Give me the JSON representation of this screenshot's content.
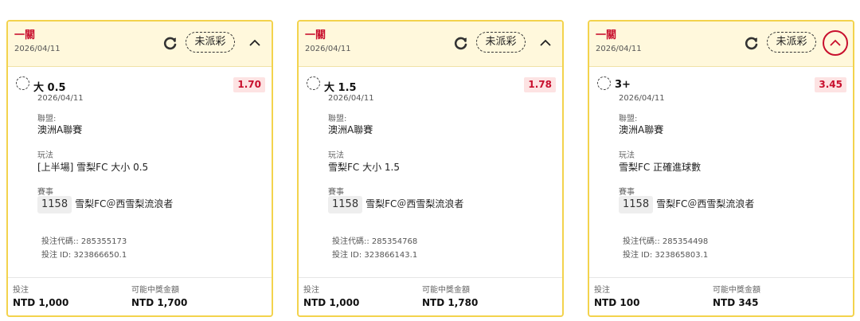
{
  "icons": {
    "refresh": "refresh-icon",
    "collapse": "chevron-up-icon",
    "radio": "radio-circle-icon"
  },
  "colors": {
    "border": "#f3d34d",
    "header_bg": "#fff8dc",
    "accent": "#c8102e",
    "odds_bg": "#fde3e3"
  },
  "cards": [
    {
      "title": "一關",
      "date": "2026/04/11",
      "status": "未派彩",
      "selection": "大 0.5",
      "odds": "1.70",
      "sel_date": "2026/04/11",
      "league_label": "聯盟:",
      "league": "澳洲A聯賽",
      "bet_type_label": "玩法",
      "bet_type": "[上半場] 雪梨FC 大小 0.5",
      "event_label": "賽事",
      "event_id": "1158",
      "event": "雪梨FC＠西雪梨流浪者",
      "bet_code": "投注代碼:: 285355173",
      "bet_id": "投注 ID: 323866650.1",
      "stake_label": "投注",
      "stake": "NTD 1,000",
      "win_label": "可能中獎金額",
      "win": "NTD 1,700"
    },
    {
      "title": "一關",
      "date": "2026/04/11",
      "status": "未派彩",
      "selection": "大 1.5",
      "odds": "1.78",
      "sel_date": "2026/04/11",
      "league_label": "聯盟:",
      "league": "澳洲A聯賽",
      "bet_type_label": "玩法",
      "bet_type": "雪梨FC 大小 1.5",
      "event_label": "賽事",
      "event_id": "1158",
      "event": "雪梨FC＠西雪梨流浪者",
      "bet_code": "投注代碼:: 285354768",
      "bet_id": "投注 ID: 323866143.1",
      "stake_label": "投注",
      "stake": "NTD 1,000",
      "win_label": "可能中獎金額",
      "win": "NTD 1,780"
    },
    {
      "title": "一關",
      "date": "2026/04/11",
      "status": "未派彩",
      "selection": "3+",
      "odds": "3.45",
      "sel_date": "2026/04/11",
      "league_label": "聯盟:",
      "league": "澳洲A聯賽",
      "bet_type_label": "玩法",
      "bet_type": "雪梨FC 正確進球數",
      "event_label": "賽事",
      "event_id": "1158",
      "event": "雪梨FC＠西雪梨流浪者",
      "bet_code": "投注代碼:: 285354498",
      "bet_id": "投注 ID: 323865803.1",
      "stake_label": "投注",
      "stake": "NTD 100",
      "win_label": "可能中獎金額",
      "win": "NTD 345"
    }
  ]
}
